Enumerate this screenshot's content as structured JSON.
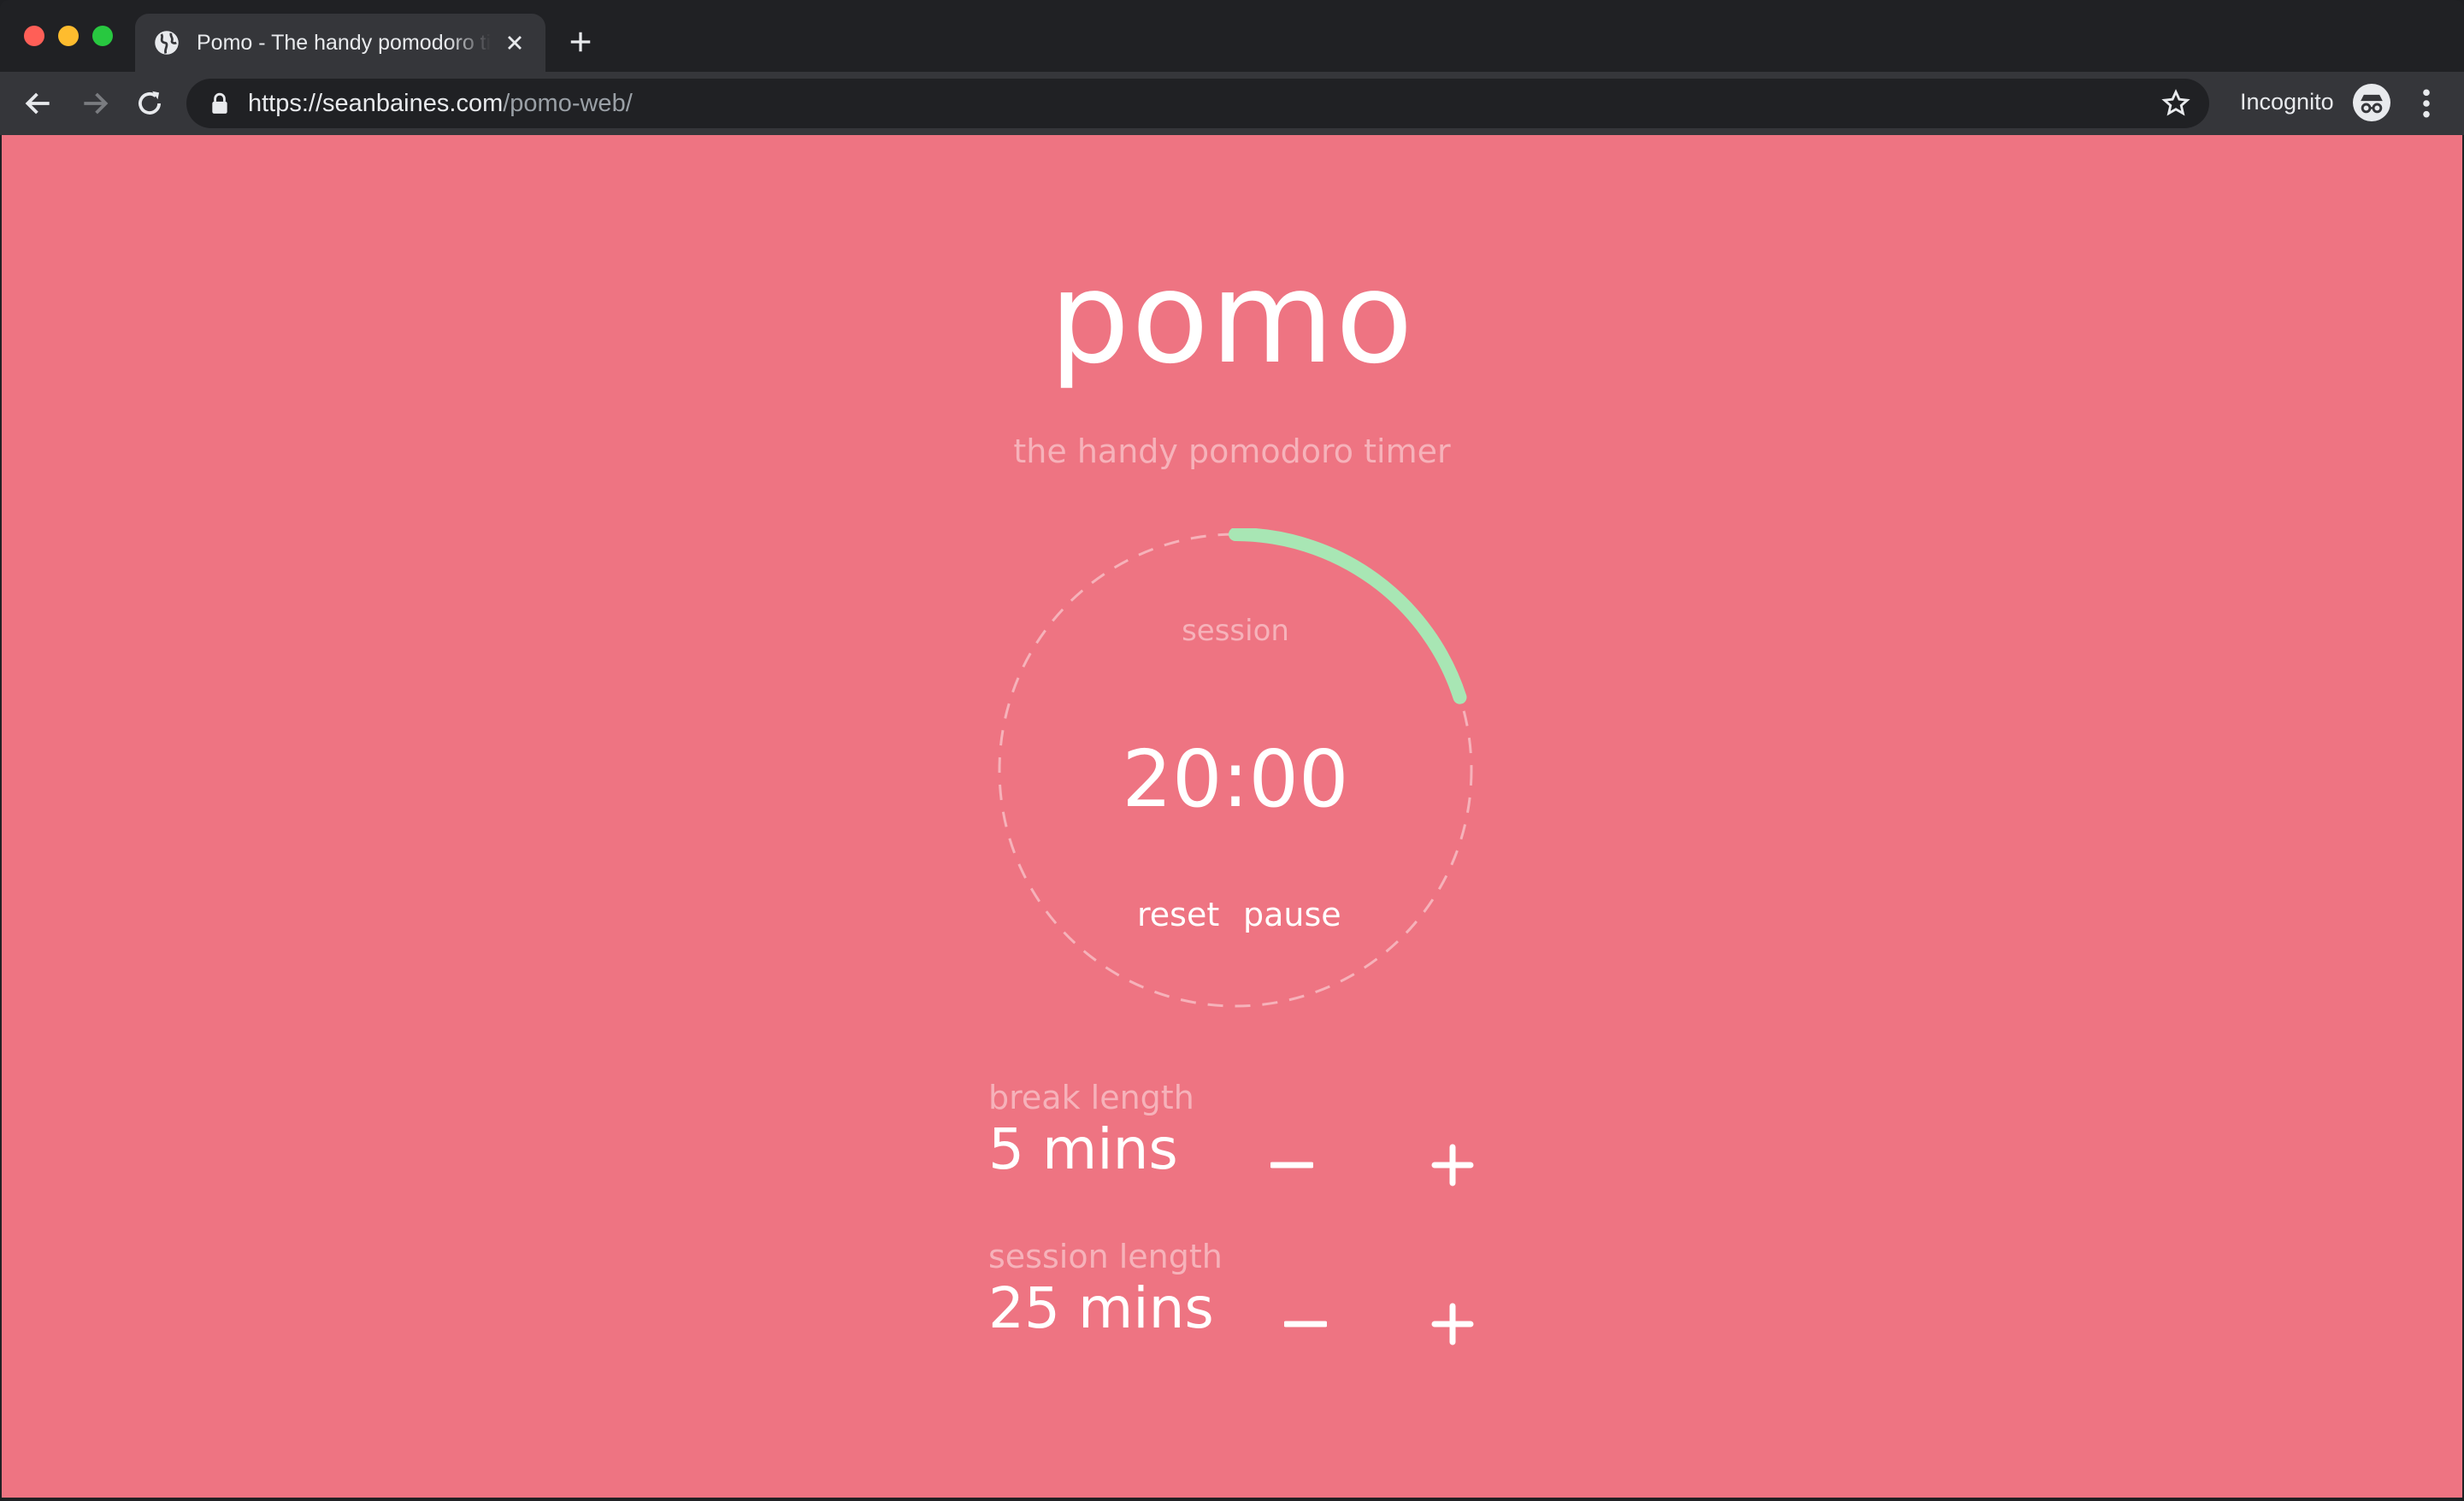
{
  "browser": {
    "tab_title": "Pomo - The handy pomodoro timer",
    "url_host": "https://seanbaines.com",
    "url_path": "/pomo-web/",
    "profile_label": "Incognito"
  },
  "app": {
    "logo": "pomo",
    "tagline": "the handy pomodoro timer",
    "timer": {
      "mode_label": "session",
      "time": "20:00",
      "progress": 0.2,
      "reset_label": "reset",
      "pause_label": "pause"
    },
    "break_setting": {
      "label": "break length",
      "value": "5 mins"
    },
    "session_setting": {
      "label": "session length",
      "value": "25 mins"
    }
  },
  "colors": {
    "page_bg": "#ee7482",
    "progress_arc": "#a8e6b4",
    "dashed_ring": "#f6b2ba",
    "muted_text": "#f6b2ba"
  },
  "icons": {
    "tab": "globe-icon",
    "close": "close-icon",
    "new_tab": "plus-icon",
    "back": "arrow-left-icon",
    "forward": "arrow-right-icon",
    "reload": "reload-icon",
    "secure": "lock-icon",
    "bookmark": "star-icon",
    "profile": "incognito-icon",
    "menu": "kebab-menu-icon",
    "decrease": "minus-icon",
    "increase": "plus-icon"
  }
}
